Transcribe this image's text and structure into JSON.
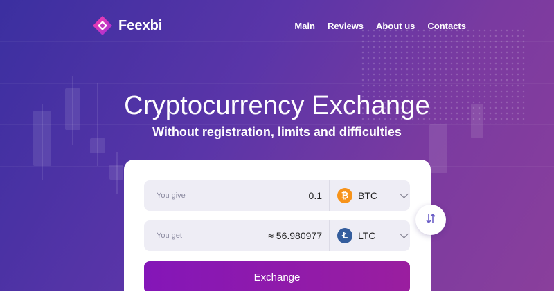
{
  "brand": {
    "name": "Feexbi"
  },
  "nav": {
    "items": [
      "Main",
      "Reviews",
      "About us",
      "Contacts"
    ]
  },
  "hero": {
    "title": "Cryptocurrency Exchange",
    "subtitle": "Without registration, limits and difficulties"
  },
  "exchange": {
    "give": {
      "label": "You give",
      "value": "0.1",
      "currency": "BTC",
      "currency_icon": "bitcoin-icon"
    },
    "get": {
      "label": "You get",
      "value": "≈ 56.980977",
      "currency": "LTC",
      "currency_icon": "litecoin-icon"
    },
    "swap_icon": "swap-arrows-icon",
    "button_label": "Exchange"
  },
  "colors": {
    "background_start": "#3b2fa0",
    "background_end": "#8a3f9c",
    "button_start": "#8416b8",
    "button_end": "#9a1e9f",
    "btc": "#f7931a",
    "ltc": "#345d9d"
  }
}
